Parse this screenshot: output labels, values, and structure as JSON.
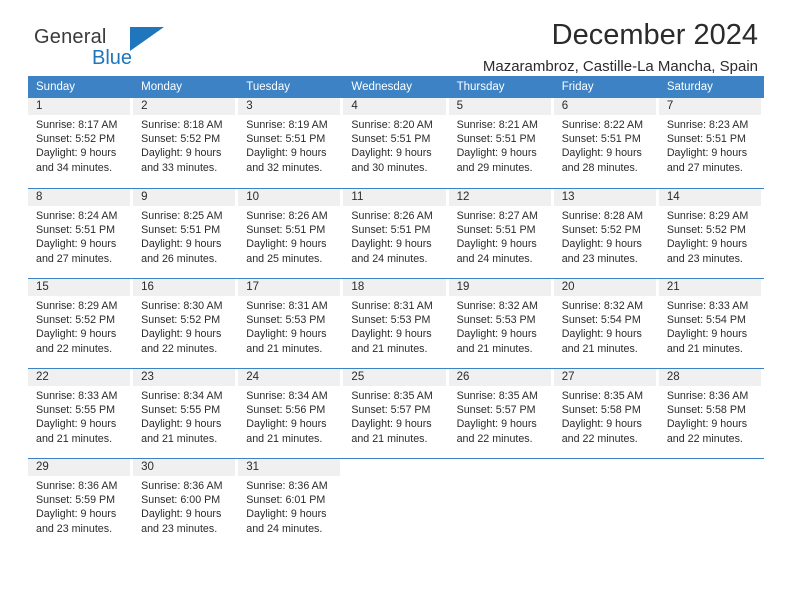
{
  "brand": {
    "word_one": "General",
    "word_two": "Blue",
    "mark": "triangle-logo",
    "accent_color": "#1f76bc"
  },
  "header": {
    "title": "December 2024",
    "subtitle": "Mazarambroz, Castille-La Mancha, Spain"
  },
  "calendar": {
    "header_bg": "#3c82c4",
    "daynum_bg": "#f0f0f0",
    "weekdays": [
      "Sunday",
      "Monday",
      "Tuesday",
      "Wednesday",
      "Thursday",
      "Friday",
      "Saturday"
    ],
    "weeks": [
      [
        {
          "day": "1",
          "sunrise": "Sunrise: 8:17 AM",
          "sunset": "Sunset: 5:52 PM",
          "daylight1": "Daylight: 9 hours",
          "daylight2": "and 34 minutes."
        },
        {
          "day": "2",
          "sunrise": "Sunrise: 8:18 AM",
          "sunset": "Sunset: 5:52 PM",
          "daylight1": "Daylight: 9 hours",
          "daylight2": "and 33 minutes."
        },
        {
          "day": "3",
          "sunrise": "Sunrise: 8:19 AM",
          "sunset": "Sunset: 5:51 PM",
          "daylight1": "Daylight: 9 hours",
          "daylight2": "and 32 minutes."
        },
        {
          "day": "4",
          "sunrise": "Sunrise: 8:20 AM",
          "sunset": "Sunset: 5:51 PM",
          "daylight1": "Daylight: 9 hours",
          "daylight2": "and 30 minutes."
        },
        {
          "day": "5",
          "sunrise": "Sunrise: 8:21 AM",
          "sunset": "Sunset: 5:51 PM",
          "daylight1": "Daylight: 9 hours",
          "daylight2": "and 29 minutes."
        },
        {
          "day": "6",
          "sunrise": "Sunrise: 8:22 AM",
          "sunset": "Sunset: 5:51 PM",
          "daylight1": "Daylight: 9 hours",
          "daylight2": "and 28 minutes."
        },
        {
          "day": "7",
          "sunrise": "Sunrise: 8:23 AM",
          "sunset": "Sunset: 5:51 PM",
          "daylight1": "Daylight: 9 hours",
          "daylight2": "and 27 minutes."
        }
      ],
      [
        {
          "day": "8",
          "sunrise": "Sunrise: 8:24 AM",
          "sunset": "Sunset: 5:51 PM",
          "daylight1": "Daylight: 9 hours",
          "daylight2": "and 27 minutes."
        },
        {
          "day": "9",
          "sunrise": "Sunrise: 8:25 AM",
          "sunset": "Sunset: 5:51 PM",
          "daylight1": "Daylight: 9 hours",
          "daylight2": "and 26 minutes."
        },
        {
          "day": "10",
          "sunrise": "Sunrise: 8:26 AM",
          "sunset": "Sunset: 5:51 PM",
          "daylight1": "Daylight: 9 hours",
          "daylight2": "and 25 minutes."
        },
        {
          "day": "11",
          "sunrise": "Sunrise: 8:26 AM",
          "sunset": "Sunset: 5:51 PM",
          "daylight1": "Daylight: 9 hours",
          "daylight2": "and 24 minutes."
        },
        {
          "day": "12",
          "sunrise": "Sunrise: 8:27 AM",
          "sunset": "Sunset: 5:51 PM",
          "daylight1": "Daylight: 9 hours",
          "daylight2": "and 24 minutes."
        },
        {
          "day": "13",
          "sunrise": "Sunrise: 8:28 AM",
          "sunset": "Sunset: 5:52 PM",
          "daylight1": "Daylight: 9 hours",
          "daylight2": "and 23 minutes."
        },
        {
          "day": "14",
          "sunrise": "Sunrise: 8:29 AM",
          "sunset": "Sunset: 5:52 PM",
          "daylight1": "Daylight: 9 hours",
          "daylight2": "and 23 minutes."
        }
      ],
      [
        {
          "day": "15",
          "sunrise": "Sunrise: 8:29 AM",
          "sunset": "Sunset: 5:52 PM",
          "daylight1": "Daylight: 9 hours",
          "daylight2": "and 22 minutes."
        },
        {
          "day": "16",
          "sunrise": "Sunrise: 8:30 AM",
          "sunset": "Sunset: 5:52 PM",
          "daylight1": "Daylight: 9 hours",
          "daylight2": "and 22 minutes."
        },
        {
          "day": "17",
          "sunrise": "Sunrise: 8:31 AM",
          "sunset": "Sunset: 5:53 PM",
          "daylight1": "Daylight: 9 hours",
          "daylight2": "and 21 minutes."
        },
        {
          "day": "18",
          "sunrise": "Sunrise: 8:31 AM",
          "sunset": "Sunset: 5:53 PM",
          "daylight1": "Daylight: 9 hours",
          "daylight2": "and 21 minutes."
        },
        {
          "day": "19",
          "sunrise": "Sunrise: 8:32 AM",
          "sunset": "Sunset: 5:53 PM",
          "daylight1": "Daylight: 9 hours",
          "daylight2": "and 21 minutes."
        },
        {
          "day": "20",
          "sunrise": "Sunrise: 8:32 AM",
          "sunset": "Sunset: 5:54 PM",
          "daylight1": "Daylight: 9 hours",
          "daylight2": "and 21 minutes."
        },
        {
          "day": "21",
          "sunrise": "Sunrise: 8:33 AM",
          "sunset": "Sunset: 5:54 PM",
          "daylight1": "Daylight: 9 hours",
          "daylight2": "and 21 minutes."
        }
      ],
      [
        {
          "day": "22",
          "sunrise": "Sunrise: 8:33 AM",
          "sunset": "Sunset: 5:55 PM",
          "daylight1": "Daylight: 9 hours",
          "daylight2": "and 21 minutes."
        },
        {
          "day": "23",
          "sunrise": "Sunrise: 8:34 AM",
          "sunset": "Sunset: 5:55 PM",
          "daylight1": "Daylight: 9 hours",
          "daylight2": "and 21 minutes."
        },
        {
          "day": "24",
          "sunrise": "Sunrise: 8:34 AM",
          "sunset": "Sunset: 5:56 PM",
          "daylight1": "Daylight: 9 hours",
          "daylight2": "and 21 minutes."
        },
        {
          "day": "25",
          "sunrise": "Sunrise: 8:35 AM",
          "sunset": "Sunset: 5:57 PM",
          "daylight1": "Daylight: 9 hours",
          "daylight2": "and 21 minutes."
        },
        {
          "day": "26",
          "sunrise": "Sunrise: 8:35 AM",
          "sunset": "Sunset: 5:57 PM",
          "daylight1": "Daylight: 9 hours",
          "daylight2": "and 22 minutes."
        },
        {
          "day": "27",
          "sunrise": "Sunrise: 8:35 AM",
          "sunset": "Sunset: 5:58 PM",
          "daylight1": "Daylight: 9 hours",
          "daylight2": "and 22 minutes."
        },
        {
          "day": "28",
          "sunrise": "Sunrise: 8:36 AM",
          "sunset": "Sunset: 5:58 PM",
          "daylight1": "Daylight: 9 hours",
          "daylight2": "and 22 minutes."
        }
      ],
      [
        {
          "day": "29",
          "sunrise": "Sunrise: 8:36 AM",
          "sunset": "Sunset: 5:59 PM",
          "daylight1": "Daylight: 9 hours",
          "daylight2": "and 23 minutes."
        },
        {
          "day": "30",
          "sunrise": "Sunrise: 8:36 AM",
          "sunset": "Sunset: 6:00 PM",
          "daylight1": "Daylight: 9 hours",
          "daylight2": "and 23 minutes."
        },
        {
          "day": "31",
          "sunrise": "Sunrise: 8:36 AM",
          "sunset": "Sunset: 6:01 PM",
          "daylight1": "Daylight: 9 hours",
          "daylight2": "and 24 minutes."
        },
        {
          "day": "",
          "sunrise": "",
          "sunset": "",
          "daylight1": "",
          "daylight2": ""
        },
        {
          "day": "",
          "sunrise": "",
          "sunset": "",
          "daylight1": "",
          "daylight2": ""
        },
        {
          "day": "",
          "sunrise": "",
          "sunset": "",
          "daylight1": "",
          "daylight2": ""
        },
        {
          "day": "",
          "sunrise": "",
          "sunset": "",
          "daylight1": "",
          "daylight2": ""
        }
      ]
    ]
  }
}
